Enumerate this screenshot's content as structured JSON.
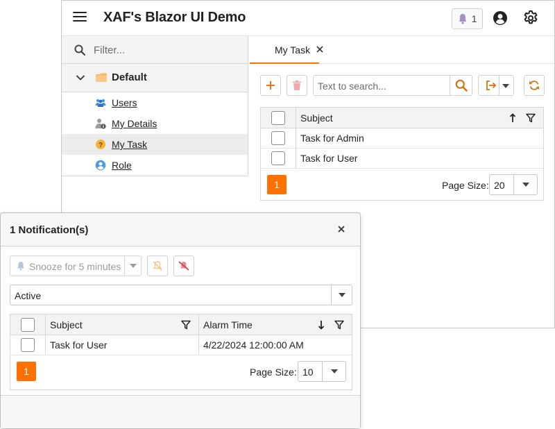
{
  "header": {
    "title": "XAF's Blazor UI Demo",
    "notification_count": "1"
  },
  "sidebar": {
    "filter_placeholder": "Filter...",
    "group_label": "Default",
    "items": [
      {
        "label": "Users",
        "icon": "users-icon"
      },
      {
        "label": "My Details",
        "icon": "user-info-icon"
      },
      {
        "label": "My Task",
        "icon": "task-question-icon"
      },
      {
        "label": "Role",
        "icon": "role-icon"
      }
    ]
  },
  "tabs": [
    {
      "label": "My Task"
    }
  ],
  "toolbar": {
    "search_placeholder": "Text to search..."
  },
  "task_grid": {
    "column_subject": "Subject",
    "rows": [
      "Task for Admin",
      "Task for User"
    ],
    "page_number": "1",
    "page_size_label": "Page Size:",
    "page_size": "20"
  },
  "dialog": {
    "title": "1 Notification(s)",
    "snooze_label": "Snooze for 5 minutes",
    "status_value": "Active",
    "grid": {
      "column_subject": "Subject",
      "column_alarm": "Alarm Time",
      "rows": [
        {
          "subject": "Task for User",
          "alarm_time": "4/22/2024 12:00:00 AM"
        }
      ],
      "page_number": "1",
      "page_size_label": "Page Size:",
      "page_size": "10"
    }
  },
  "colors": {
    "accent": "#ff7200",
    "delete_disabled": "#f0a8a8",
    "bell": "#a58fc7"
  }
}
